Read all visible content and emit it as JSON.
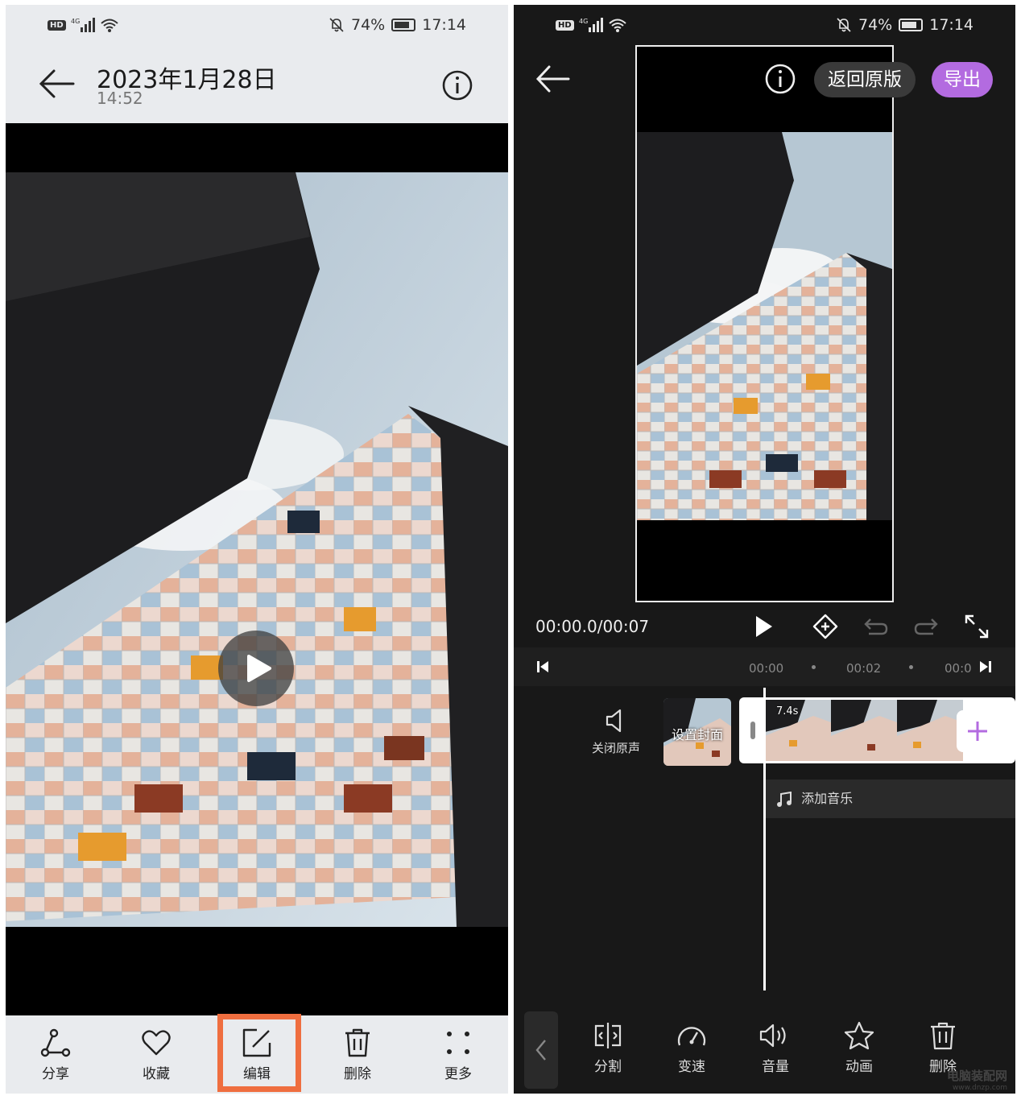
{
  "left": {
    "status": {
      "battery": "74%",
      "time": "17:14",
      "hd": "HD",
      "network": "4G"
    },
    "header": {
      "title": "2023年1月28日",
      "subtitle": "14:52"
    },
    "toolbar": [
      {
        "label": "分享",
        "icon": "share-icon"
      },
      {
        "label": "收藏",
        "icon": "heart-icon"
      },
      {
        "label": "编辑",
        "icon": "edit-icon"
      },
      {
        "label": "删除",
        "icon": "trash-icon"
      },
      {
        "label": "更多",
        "icon": "more-dots-icon"
      }
    ],
    "highlight_color": "#ef6e3f"
  },
  "right": {
    "status": {
      "battery": "74%",
      "time": "17:14",
      "hd": "HD",
      "network": "4G"
    },
    "revert_label": "返回原版",
    "export_label": "导出",
    "export_color": "#b36be0",
    "time_display": "00:00.0/00:07",
    "ruler": [
      "00:00",
      "00:02",
      "00:0"
    ],
    "mute_label": "关闭原声",
    "cover_label": "设置封面",
    "clip_duration": "7.4s",
    "add_music_label": "添加音乐",
    "toolbar": [
      {
        "label": "分割",
        "icon": "split-icon"
      },
      {
        "label": "变速",
        "icon": "speed-icon"
      },
      {
        "label": "音量",
        "icon": "volume-icon"
      },
      {
        "label": "动画",
        "icon": "star-icon"
      },
      {
        "label": "删除",
        "icon": "trash-icon"
      }
    ]
  },
  "watermark": {
    "text": "电脑装配网",
    "url": "www.dnzp.com"
  }
}
